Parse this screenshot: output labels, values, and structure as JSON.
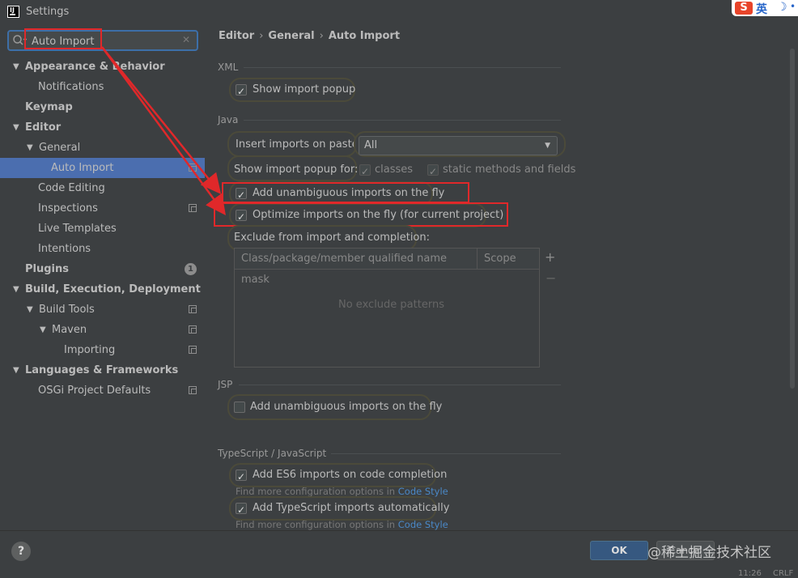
{
  "window": {
    "title": "Settings"
  },
  "ime": {
    "logo": "S",
    "lang": "英",
    "moon": "☽",
    "extra": "•"
  },
  "search": {
    "value": "Auto Import"
  },
  "tree": [
    {
      "label": "Appearance & Behavior",
      "arrow": "▼",
      "bold": true
    },
    {
      "label": "Notifications"
    },
    {
      "label": "Keymap",
      "bold": true
    },
    {
      "label": "Editor",
      "arrow": "▼",
      "bold": true
    },
    {
      "label": "General",
      "arrow": "▼"
    },
    {
      "label": "Auto Import",
      "selected": true
    },
    {
      "label": "Code Editing"
    },
    {
      "label": "Inspections"
    },
    {
      "label": "Live Templates"
    },
    {
      "label": "Intentions"
    },
    {
      "label": "Plugins",
      "bold": true,
      "badge": "1"
    },
    {
      "label": "Build, Execution, Deployment",
      "arrow": "▼",
      "bold": true
    },
    {
      "label": "Build Tools",
      "arrow": "▼"
    },
    {
      "label": "Maven",
      "arrow": "▼"
    },
    {
      "label": "Importing"
    },
    {
      "label": "Languages & Frameworks",
      "arrow": "▼",
      "bold": true
    },
    {
      "label": "OSGi Project Defaults"
    }
  ],
  "breadcrumb": {
    "part1": "Editor",
    "part2": "General",
    "part3": "Auto Import",
    "sep": "›"
  },
  "xml": {
    "section": "XML",
    "show_import_popup": {
      "label": "Show import popup",
      "checked": true
    }
  },
  "java": {
    "section": "Java",
    "insert_on_paste_label": "Insert imports on paste:",
    "insert_on_paste_value": "All",
    "show_popup_for_label": "Show import popup for:",
    "classes": {
      "label": "classes",
      "checked": true
    },
    "static_methods": {
      "label": "static methods and fields",
      "checked": true
    },
    "add_unambiguous": {
      "label": "Add unambiguous imports on the fly",
      "checked": true
    },
    "optimize_imports": {
      "label": "Optimize imports on the fly (for current project)",
      "checked": true
    },
    "exclude_label": "Exclude from import and completion:",
    "table": {
      "columns": [
        "Class/package/member qualified name mask",
        "Scope"
      ],
      "empty_text": "No exclude patterns",
      "add": "+",
      "remove": "−"
    }
  },
  "jsp": {
    "section": "JSP",
    "add_unambiguous": {
      "label": "Add unambiguous imports on the fly",
      "checked": false
    }
  },
  "ts": {
    "section": "TypeScript / JavaScript",
    "es6": {
      "label": "Add ES6 imports on code completion",
      "checked": true
    },
    "hint_prefix": "Find more configuration options in",
    "hint_link": "Code Style",
    "ts_auto": {
      "label": "Add TypeScript imports automatically",
      "checked": true
    }
  },
  "footer": {
    "help": "?",
    "ok": "OK",
    "cancel": "Cancel",
    "watermark": "@稀土掘金技术社区",
    "time": "11:26",
    "encoding": "CRLF"
  },
  "colors": {
    "accent": "#4b6eaf",
    "annotation": "#e0282a",
    "ok_button": "#365880"
  }
}
